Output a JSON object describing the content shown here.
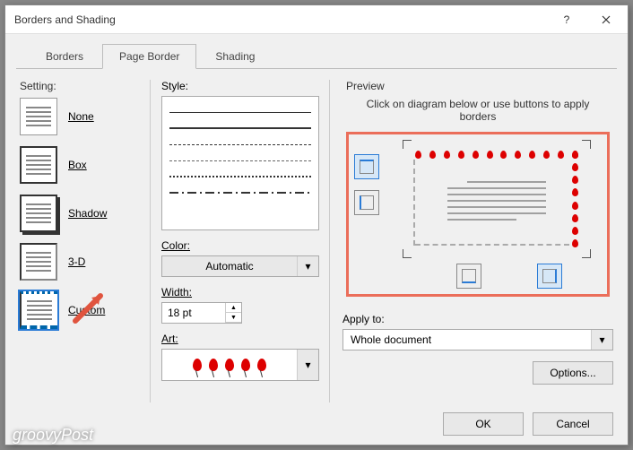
{
  "title": "Borders and Shading",
  "tabs": {
    "borders": "Borders",
    "page_border": "Page Border",
    "shading": "Shading"
  },
  "setting": {
    "label": "Setting:",
    "items": [
      "None",
      "Box",
      "Shadow",
      "3-D",
      "Custom"
    ]
  },
  "style": {
    "label": "Style:"
  },
  "color": {
    "label": "Color:",
    "value": "Automatic"
  },
  "width": {
    "label": "Width:",
    "value": "18 pt"
  },
  "art": {
    "label": "Art:"
  },
  "preview": {
    "label": "Preview",
    "hint": "Click on diagram below or use buttons to apply borders"
  },
  "apply": {
    "label": "Apply to:",
    "value": "Whole document"
  },
  "buttons": {
    "options": "Options...",
    "ok": "OK",
    "cancel": "Cancel"
  },
  "watermark": "groovyPost"
}
